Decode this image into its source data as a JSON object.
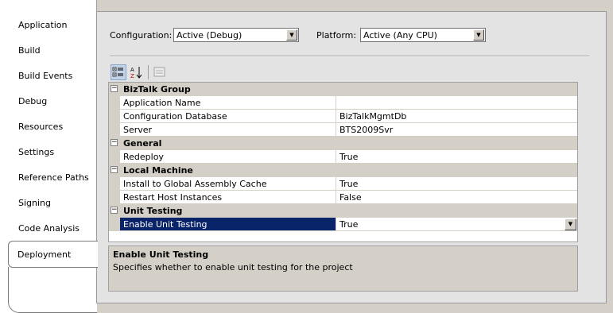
{
  "tabs": [
    {
      "label": "Application"
    },
    {
      "label": "Build"
    },
    {
      "label": "Build Events"
    },
    {
      "label": "Debug"
    },
    {
      "label": "Resources"
    },
    {
      "label": "Settings"
    },
    {
      "label": "Reference Paths"
    },
    {
      "label": "Signing"
    },
    {
      "label": "Code Analysis"
    },
    {
      "label": "Deployment",
      "selected": true
    }
  ],
  "config": {
    "configuration_label": "Configuration:",
    "configuration_value": "Active (Debug)",
    "platform_label": "Platform:",
    "platform_value": "Active (Any CPU)"
  },
  "toolbar": {
    "categorized_icon": "categorized-icon",
    "alphabetical_icon": "alphabetical-icon",
    "property_pages_icon": "property-pages-icon"
  },
  "grid": {
    "categories": [
      {
        "name": "BizTalk Group",
        "expander": "⊟",
        "properties": [
          {
            "name": "Application Name",
            "value": ""
          },
          {
            "name": "Configuration Database",
            "value": "BizTalkMgmtDb"
          },
          {
            "name": "Server",
            "value": "BTS2009Svr"
          }
        ]
      },
      {
        "name": "General",
        "expander": "⊟",
        "properties": [
          {
            "name": "Redeploy",
            "value": "True"
          }
        ]
      },
      {
        "name": "Local Machine",
        "expander": "⊟",
        "properties": [
          {
            "name": "Install to Global Assembly Cache",
            "value": "True"
          },
          {
            "name": "Restart Host Instances",
            "value": "False"
          }
        ]
      },
      {
        "name": "Unit Testing",
        "expander": "⊟",
        "properties": [
          {
            "name": "Enable Unit Testing",
            "value": "True",
            "selected": true
          }
        ]
      }
    ]
  },
  "description": {
    "title": "Enable Unit Testing",
    "text": "Specifies whether to enable unit testing for the project"
  },
  "colors": {
    "selection": "#0a246a",
    "category_bg": "#d4d0c8"
  }
}
